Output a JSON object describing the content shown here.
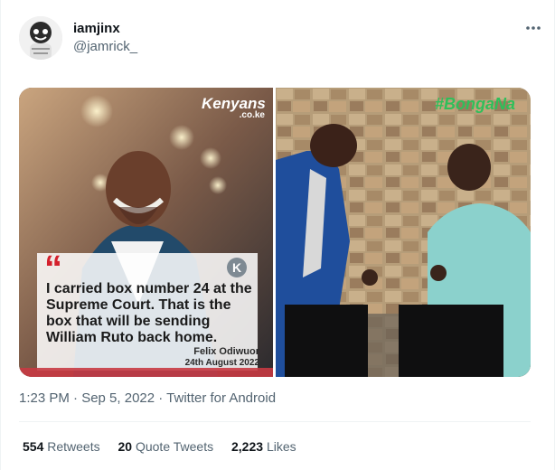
{
  "tweet": {
    "display_name": "iamjinx",
    "handle": "@jamrick_",
    "timestamp": "1:23 PM · Sep 5, 2022 · Twitter for Android",
    "stats": {
      "retweets_count": "554",
      "retweets_label": "Retweets",
      "quotes_count": "20",
      "quotes_label": "Quote Tweets",
      "likes_count": "2,223",
      "likes_label": "Likes"
    }
  },
  "media": {
    "left": {
      "brand": "Kenyans",
      "brand_sub": ".co.ke",
      "quote_mark": "“",
      "quote": "I carried box number 24 at the Supreme Court. That is the box that will be sending William Ruto back home.",
      "author": "Felix Odiwuor",
      "date": "24th August 2022"
    },
    "right": {
      "hashtag": "#BongaNa"
    }
  },
  "colors": {
    "brand_red": "#d4202c",
    "secondary_text": "#536471",
    "hashtag_green": "#2fbf5a"
  }
}
